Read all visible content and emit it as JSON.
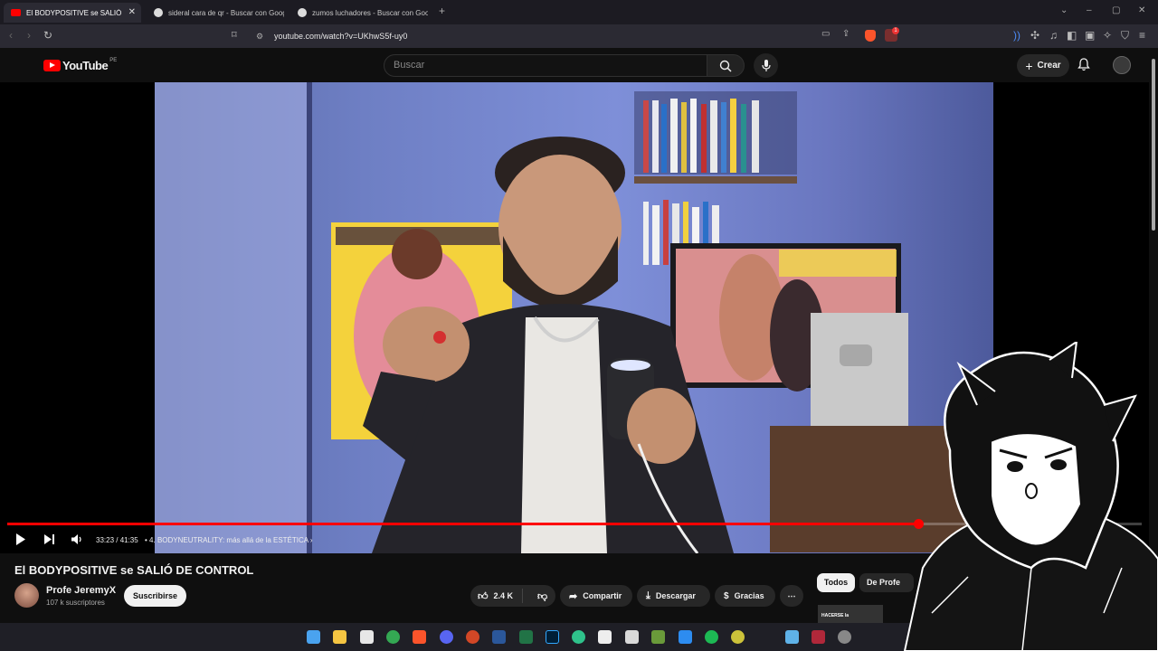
{
  "browser": {
    "tabs": [
      {
        "title": "El BODYPOSITIVE se SALIÓ DE CONTROL - YouTube",
        "active": true,
        "favicon_color": "#ff0000"
      },
      {
        "title": "sideral cara de qr - Buscar con Google",
        "active": false,
        "favicon_color": "#dcdcdc"
      },
      {
        "title": "zumos luchadores - Buscar con Google",
        "active": false,
        "favicon_color": "#dcdcdc"
      }
    ],
    "close_glyph": "✕",
    "new_tab_glyph": "+",
    "url": "youtube.com/watch?v=UKhwS5f-uy0",
    "shield_badge": "1"
  },
  "youtube": {
    "logo_text": "YouTube",
    "country_code": "PE",
    "search_placeholder": "Buscar",
    "create_label": "Crear"
  },
  "player": {
    "current_time": "33:23",
    "duration": "41:35",
    "time_display": "33:23 / 41:35",
    "chapter_separator": "•",
    "chapter": "4. BODYNEUTRALITY: más allá de la ESTÉTICA",
    "progress_fraction": 0.8027,
    "accent": "#ff0000"
  },
  "video_info": {
    "title": "El BODYPOSITIVE se SALIÓ DE CONTROL",
    "channel_name": "Profe JeremyX",
    "subscribers": "107 k suscriptores",
    "subscribe_label": "Suscribirse",
    "likes": "2.4 K",
    "share_label": "Compartir",
    "download_label": "Descargar",
    "thanks_label": "Gracias",
    "more_glyph": "⋯"
  },
  "related": {
    "chips": [
      "Todos",
      "De Profe"
    ],
    "thumb_text": "HACERSE la"
  },
  "taskbar": {
    "icons": [
      "windows-start-icon",
      "file-explorer-icon",
      "store-icon",
      "chrome-icon",
      "brave-icon",
      "discord-icon",
      "powerpoint-icon",
      "word-icon",
      "excel-icon",
      "photoshop-icon",
      "edge-icon",
      "capcut-icon",
      "app-icon",
      "minecraft-icon",
      "app3-icon",
      "spotify-icon",
      "xbox-icon",
      "notepad-icon",
      "anime-app-icon",
      "settings-icon"
    ]
  }
}
